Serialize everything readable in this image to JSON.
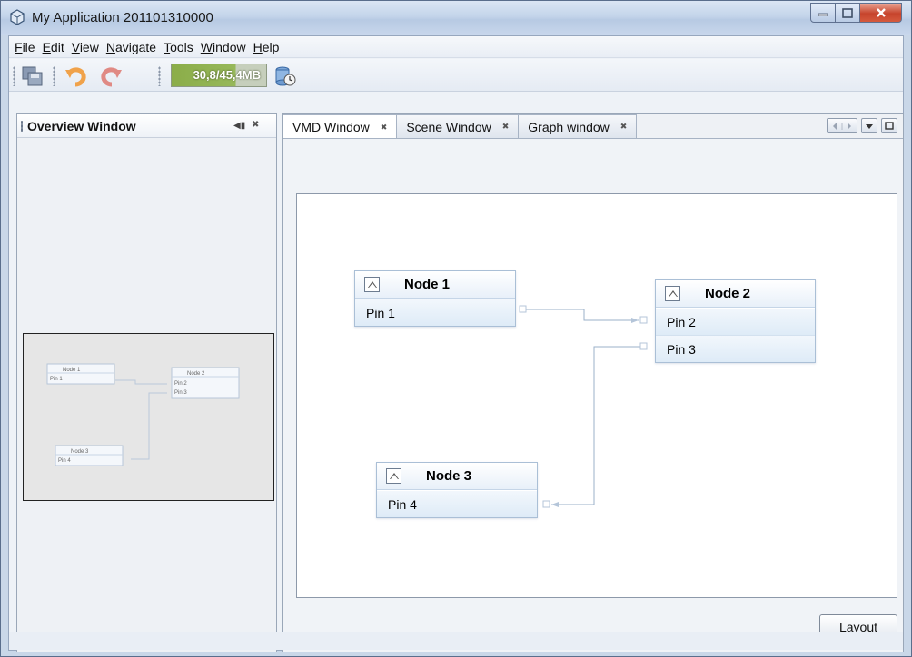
{
  "window": {
    "title": "My Application 201101310000"
  },
  "menu": {
    "items": [
      {
        "mnemonic": "F",
        "rest": "ile"
      },
      {
        "mnemonic": "E",
        "rest": "dit"
      },
      {
        "mnemonic": "V",
        "rest": "iew"
      },
      {
        "mnemonic": "N",
        "rest": "avigate"
      },
      {
        "mnemonic": "T",
        "rest": "ools"
      },
      {
        "mnemonic": "W",
        "rest": "indow"
      },
      {
        "mnemonic": "H",
        "rest": "elp"
      }
    ]
  },
  "toolbar": {
    "memory_label": "30,8/45,4MB",
    "memory_used_fraction": 0.68,
    "icons": [
      "save-all-icon",
      "undo-icon",
      "redo-icon",
      "garbage-collect-icon"
    ]
  },
  "overview": {
    "title": "Overview Window",
    "min_glyph": "◀▮",
    "close_glyph": "✖"
  },
  "tabs": [
    {
      "label": "VMD Window",
      "active": true
    },
    {
      "label": "Scene Window",
      "active": false
    },
    {
      "label": "Graph window",
      "active": false
    }
  ],
  "tab_close_glyph": "✖",
  "graph": {
    "nodes": [
      {
        "title": "Node 1",
        "pins": [
          "Pin 1"
        ]
      },
      {
        "title": "Node 2",
        "pins": [
          "Pin 2",
          "Pin 3"
        ]
      },
      {
        "title": "Node 3",
        "pins": [
          "Pin 4"
        ]
      }
    ],
    "edges": [
      {
        "from": "Pin 1",
        "to": "Pin 2"
      },
      {
        "from": "Pin 3",
        "to": "Pin 4"
      }
    ]
  },
  "layout_button": "Layout",
  "colors": {
    "node_border": "#aabfd6",
    "edge": "#9bb1ca",
    "memory_bar": "#8bad49"
  }
}
